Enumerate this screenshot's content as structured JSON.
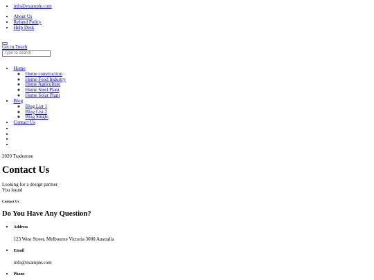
{
  "topbar": {
    "email_link": "info@example.com",
    "links": [
      "About Us",
      "Refund Policy",
      "Help Desk"
    ]
  },
  "header": {
    "get_in_touch": "Get in Touch",
    "search_placeholder": "Type to search"
  },
  "nav": {
    "home": "Home",
    "home_sub": [
      "Home construction",
      "Home Food Industry",
      "Home Agriculture",
      "Home Steel Plant",
      "Home Solar Plant"
    ],
    "blog": "Blog",
    "blog_sub": [
      "Blog List 1",
      "Blog List 2",
      "Blog Single"
    ],
    "contact": "Contact Us"
  },
  "social": {
    "icons": [
      "social-icon-1",
      "social-icon-2",
      "social-icon-3",
      "social-icon-4"
    ]
  },
  "footer_brand": {
    "copyright": "2020 Tradezone"
  },
  "hero": {
    "title": "Contact Us",
    "line1": "Looking for a design partner",
    "line2": "You found"
  },
  "contact_section": {
    "tag": "Contact Us",
    "title": "Do You Have Any Question?",
    "items": [
      {
        "heading": "Address",
        "value": "123 West Street, Melbourne Victoria 3000 Australia"
      },
      {
        "heading": "Email",
        "value": "info@example.com"
      },
      {
        "heading": "Phone",
        "value": ""
      }
    ]
  },
  "colors": {
    "link": "#0000ee",
    "text": "#000000",
    "background": "#ffffff"
  }
}
